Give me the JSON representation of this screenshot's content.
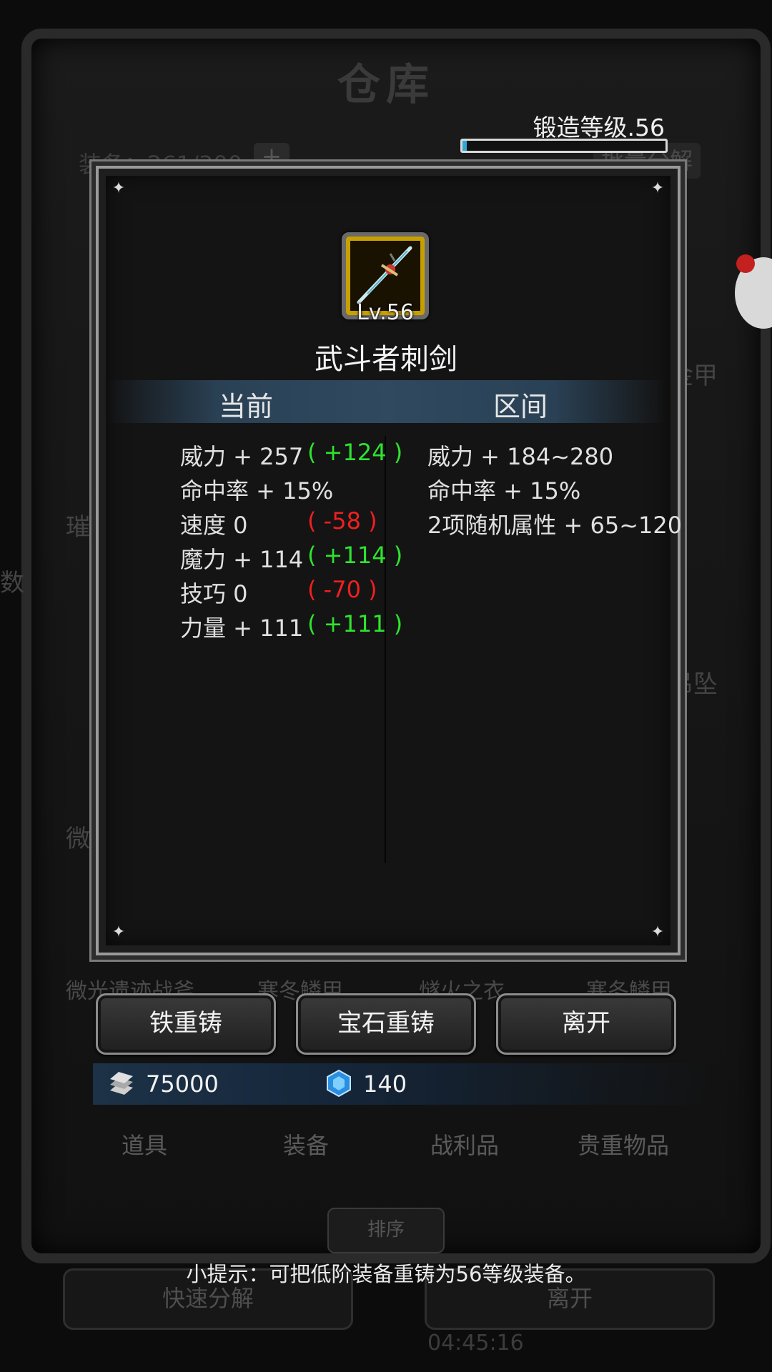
{
  "background": {
    "title": "仓库",
    "equipment_count": "装备：261/300",
    "plus": "+",
    "batch_decompose": "批量分解",
    "side_labels": [
      "璀璨",
      "微光",
      "微光遗迹战斧",
      "寒冬鳞甲",
      "燧火之衣",
      "寒冬鳞甲",
      "金甲",
      "吊坠",
      "数"
    ],
    "tabs": [
      "道具",
      "装备",
      "战利品",
      "贵重物品"
    ],
    "sort_label": "排序",
    "quick_decompose": "快速分解",
    "leave": "离开",
    "time": "04:45:16"
  },
  "forge": {
    "level_label": "锻造等级.56",
    "progress": 0.02
  },
  "item": {
    "icon": "sword-icon",
    "level": "Lv.56",
    "name": "武斗者刺剑"
  },
  "headers": {
    "current": "当前",
    "range": "区间"
  },
  "current_stats": [
    {
      "label": "威力 + 257",
      "diff": "( +124 )",
      "sign": "pos"
    },
    {
      "label": "命中率 + 15%",
      "diff": "",
      "sign": ""
    },
    {
      "label": "速度  0",
      "diff": "( -58 )",
      "sign": "neg"
    },
    {
      "label": "魔力 + 114",
      "diff": "( +114 )",
      "sign": "pos"
    },
    {
      "label": "技巧  0",
      "diff": "( -70 )",
      "sign": "neg"
    },
    {
      "label": "力量 + 111",
      "diff": "( +111 )",
      "sign": "pos"
    }
  ],
  "range_stats": [
    "威力 + 184~280",
    "命中率 + 15%",
    "2项随机属性 + 65~120"
  ],
  "buttons": {
    "iron_recast": "铁重铸",
    "gem_recast": "宝石重铸",
    "leave": "离开"
  },
  "currency": {
    "iron": "75000",
    "gem": "140"
  },
  "hint": "小提示：可把低阶装备重铸为56等级装备。",
  "colors": {
    "positive": "#2fe32f",
    "negative": "#ef2020",
    "accent_blue": "#2fa8d8",
    "icon_frame_gold": "#c7a000"
  }
}
